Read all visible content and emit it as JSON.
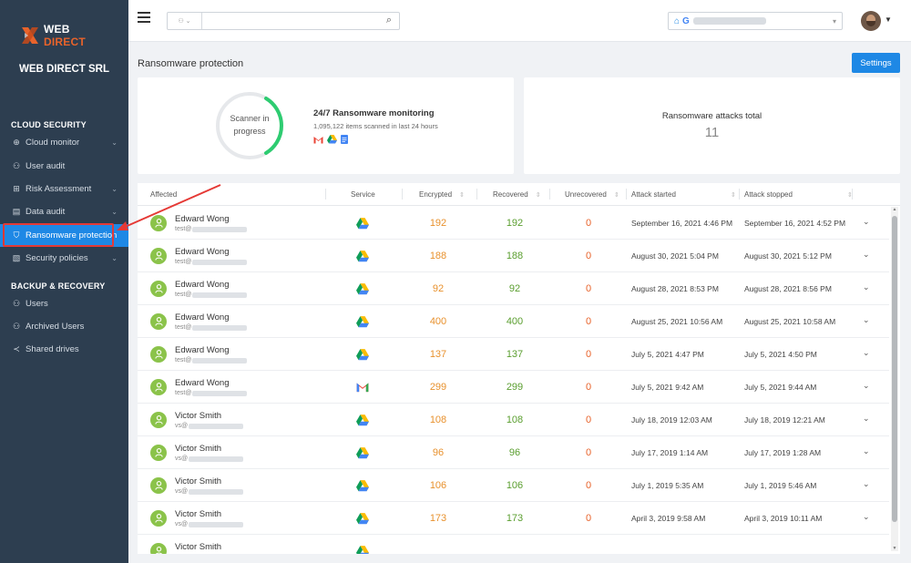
{
  "brand": {
    "name_web": "WEB",
    "name_direct": "DIRECT",
    "company": "WEB DIRECT SRL",
    "accent": "#e8632b"
  },
  "sidebar": {
    "sections": {
      "cloud": "CLOUD SECURITY",
      "backup": "BACKUP & RECOVERY"
    },
    "items": [
      {
        "label": "Cloud monitor"
      },
      {
        "label": "User audit"
      },
      {
        "label": "Risk Assessment"
      },
      {
        "label": "Data audit"
      },
      {
        "label": "Ransomware protection"
      },
      {
        "label": "Security policies"
      },
      {
        "label": "Users"
      },
      {
        "label": "Archived Users"
      },
      {
        "label": "Shared drives"
      }
    ]
  },
  "header": {
    "page_title": "Ransomware protection",
    "settings_label": "Settings"
  },
  "monitor": {
    "status_line1": "Scanner in",
    "status_line2": "progress",
    "title": "24/7 Ransomware monitoring",
    "subtitle": "1,095,122 items scanned in last 24 hours"
  },
  "attacks": {
    "title": "Ransomware attacks total",
    "value": "11"
  },
  "table": {
    "headers": [
      "Affected",
      "Service",
      "Encrypted",
      "Recovered",
      "Unrecovered",
      "Attack started",
      "Attack stopped"
    ],
    "rows": [
      {
        "name": "Edward Wong",
        "mail": "test@",
        "service": "drive",
        "encrypted": "192",
        "recovered": "192",
        "unrecovered": "0",
        "started": "September 16, 2021 4:46 PM",
        "stopped": "September 16, 2021 4:52 PM"
      },
      {
        "name": "Edward Wong",
        "mail": "test@",
        "service": "drive",
        "encrypted": "188",
        "recovered": "188",
        "unrecovered": "0",
        "started": "August 30, 2021 5:04 PM",
        "stopped": "August 30, 2021 5:12 PM"
      },
      {
        "name": "Edward Wong",
        "mail": "test@",
        "service": "drive",
        "encrypted": "92",
        "recovered": "92",
        "unrecovered": "0",
        "started": "August 28, 2021 8:53 PM",
        "stopped": "August 28, 2021 8:56 PM"
      },
      {
        "name": "Edward Wong",
        "mail": "test@",
        "service": "drive",
        "encrypted": "400",
        "recovered": "400",
        "unrecovered": "0",
        "started": "August 25, 2021 10:56 AM",
        "stopped": "August 25, 2021 10:58 AM"
      },
      {
        "name": "Edward Wong",
        "mail": "test@",
        "service": "drive",
        "encrypted": "137",
        "recovered": "137",
        "unrecovered": "0",
        "started": "July 5, 2021 4:47 PM",
        "stopped": "July 5, 2021 4:50 PM"
      },
      {
        "name": "Edward Wong",
        "mail": "test@",
        "service": "gmail",
        "encrypted": "299",
        "recovered": "299",
        "unrecovered": "0",
        "started": "July 5, 2021 9:42 AM",
        "stopped": "July 5, 2021 9:44 AM"
      },
      {
        "name": "Victor Smith",
        "mail": "vs@",
        "service": "drive",
        "encrypted": "108",
        "recovered": "108",
        "unrecovered": "0",
        "started": "July 18, 2019 12:03 AM",
        "stopped": "July 18, 2019 12:21 AM"
      },
      {
        "name": "Victor Smith",
        "mail": "vs@",
        "service": "drive",
        "encrypted": "96",
        "recovered": "96",
        "unrecovered": "0",
        "started": "July 17, 2019 1:14 AM",
        "stopped": "July 17, 2019 1:28 AM"
      },
      {
        "name": "Victor Smith",
        "mail": "vs@",
        "service": "drive",
        "encrypted": "106",
        "recovered": "106",
        "unrecovered": "0",
        "started": "July 1, 2019 5:35 AM",
        "stopped": "July 1, 2019 5:46 AM"
      },
      {
        "name": "Victor Smith",
        "mail": "vs@",
        "service": "drive",
        "encrypted": "173",
        "recovered": "173",
        "unrecovered": "0",
        "started": "April 3, 2019 9:58 AM",
        "stopped": "April 3, 2019 10:11 AM"
      },
      {
        "name": "Victor Smith",
        "mail": "",
        "service": "drive",
        "encrypted": "",
        "recovered": "",
        "unrecovered": "",
        "started": "",
        "stopped": ""
      }
    ]
  },
  "colors": {
    "sidebar_bg": "#2d3e50",
    "active": "#1e88e5",
    "encrypted": "#e8912d",
    "recovered": "#5a9e2f",
    "unrecovered": "#e8632b",
    "avatar": "#8bc34a"
  }
}
